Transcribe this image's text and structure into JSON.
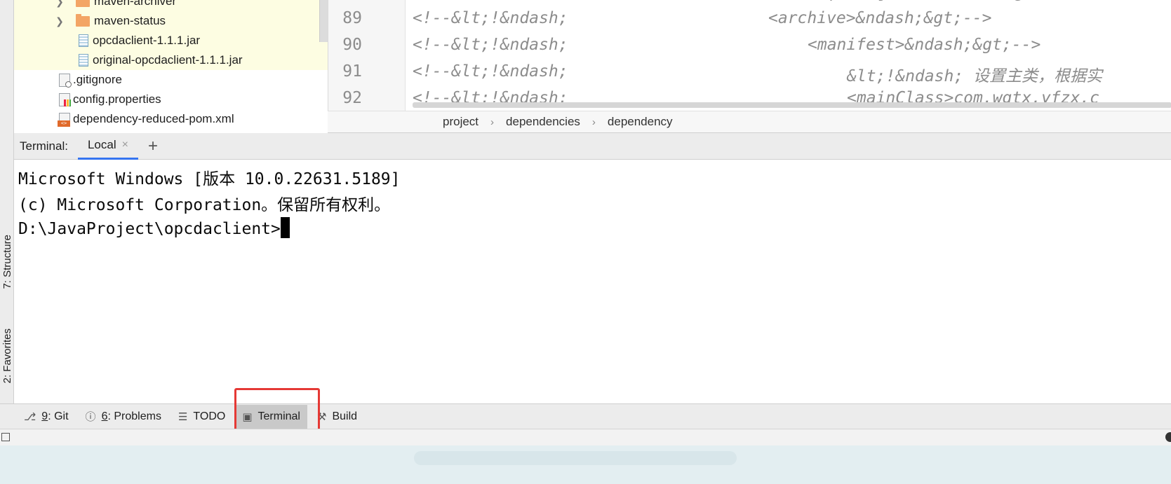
{
  "project_tree": {
    "items": [
      {
        "name": "maven-archiver",
        "type": "folder"
      },
      {
        "name": "maven-status",
        "type": "folder"
      },
      {
        "name": "opcdaclient-1.1.1.jar",
        "type": "jar"
      },
      {
        "name": "original-opcdaclient-1.1.1.jar",
        "type": "jar"
      },
      {
        "name": ".gitignore",
        "type": "file"
      },
      {
        "name": "config.properties",
        "type": "file"
      },
      {
        "name": "dependency-reduced-pom.xml",
        "type": "file"
      }
    ]
  },
  "editor": {
    "lines": [
      {
        "num": "89",
        "prefix": "<!--&lt;!&ndash;",
        "code": "<archive>&ndash;&gt;-->"
      },
      {
        "num": "90",
        "prefix": "<!--&lt;!&ndash;",
        "code": "<manifest>&ndash;&gt;-->"
      },
      {
        "num": "91",
        "prefix": "<!--&lt;!&ndash;",
        "code": "&lt;!&ndash; 设置主类，根据实"
      },
      {
        "num": "92",
        "prefix": "<!--&lt;!&ndash;",
        "code": "<mainClass>com.wgtx.yfzx.c"
      }
    ]
  },
  "breadcrumb": [
    "project",
    "dependencies",
    "dependency"
  ],
  "terminal": {
    "title": "Terminal:",
    "tab_label": "Local",
    "close_glyph": "×",
    "add_glyph": "+",
    "lines": [
      "Microsoft Windows [版本 10.0.22631.5189]",
      "(c) Microsoft Corporation。保留所有权利。"
    ],
    "prompt": "D:\\JavaProject\\opcdaclient>"
  },
  "side_tabs": {
    "structure": "7: Structure",
    "favorites": "2: Favorites"
  },
  "tool_windows": [
    {
      "key": "9",
      "label": ": Git",
      "icon": "git-branch-icon"
    },
    {
      "key": "6",
      "label": ": Problems",
      "icon": "problems-icon"
    },
    {
      "key": "",
      "label": "TODO",
      "icon": "todo-list-icon"
    },
    {
      "key": "",
      "label": "Terminal",
      "icon": "terminal-icon",
      "active": true
    },
    {
      "key": "",
      "label": "Build",
      "icon": "hammer-icon"
    }
  ],
  "colors": {
    "highlight_box": "#e53935",
    "tab_underline": "#3574f0",
    "tree_highlight": "#fdfde2"
  }
}
